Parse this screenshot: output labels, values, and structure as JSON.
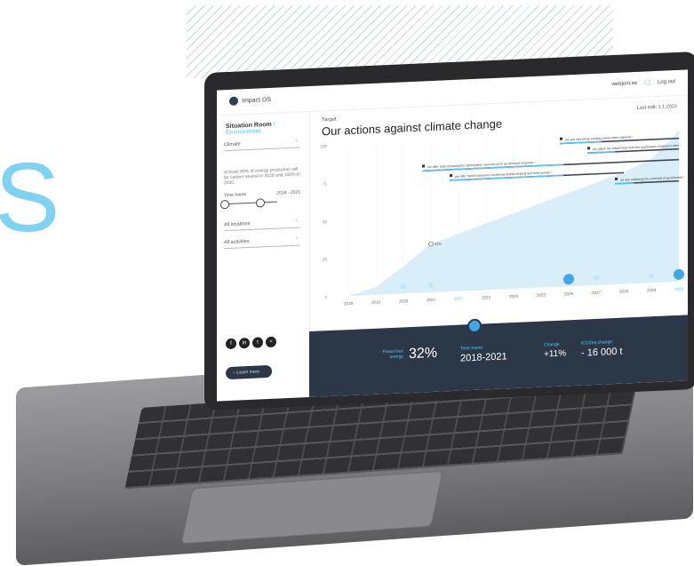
{
  "hero_letter": "S",
  "screen": {
    "brand": "Impact OS",
    "topbar": {
      "user": "webjoni.ee",
      "logout": "Log out"
    },
    "sidebar": {
      "title_main": "Situation Room",
      "title_sub": "/ Environment",
      "select_climate": "Climate",
      "note": "At least 80% of energy production will be carbon neutral in 2028 and 100% in 2030.",
      "time_frame_label": "Time frame",
      "time_frame_value": "2018 - 2021",
      "select_locations": "All locations",
      "select_activities": "All activities",
      "learn_more": "Learn more"
    },
    "main": {
      "target_label": "Target",
      "headline": "Our actions against climate change",
      "last_edit": "Last edit: 1.1.2022",
      "marker_label": "32%"
    },
    "footer": {
      "fossil_label": "Fossil-free energy",
      "fossil_value": "32%",
      "timeframe_label": "Time frame",
      "timeframe_value": "2018-2021",
      "change_label": "Change",
      "change_value": "+11%",
      "co2_label": "tCO2eq change",
      "co2_value": "- 16 000 t"
    }
  },
  "chart_data": {
    "type": "area",
    "categories": [
      "2018",
      "2019",
      "2020",
      "2021",
      "2022",
      "2023",
      "2024",
      "2025",
      "2026",
      "2027",
      "2028",
      "2029",
      "2030"
    ],
    "series": [
      {
        "values": [
          0,
          5,
          18,
          32,
          38,
          44,
          50,
          56,
          62,
          68,
          74,
          82,
          100
        ]
      }
    ],
    "y_ticks": [
      "0",
      "25",
      "50",
      "75",
      "100"
    ],
    "ylim": [
      0,
      100
    ],
    "actions": [
      {
        "label": "we are improving existing power plant capacity"
      },
      {
        "label": "we utilize the waste heat from the wastewater treatment plant"
      },
      {
        "label": "we offer heat consumption optimization services such as demand response"
      },
      {
        "label": "we offer hybrid solutions combining district heating and heat pumps"
      },
      {
        "label": "we are exploring the potential of geothermal"
      }
    ],
    "colors": {
      "area": "#d9eef8",
      "bar_done": "#5cc3ee",
      "bar_rest": "#444a55",
      "accent": "#3fa9e8"
    }
  }
}
